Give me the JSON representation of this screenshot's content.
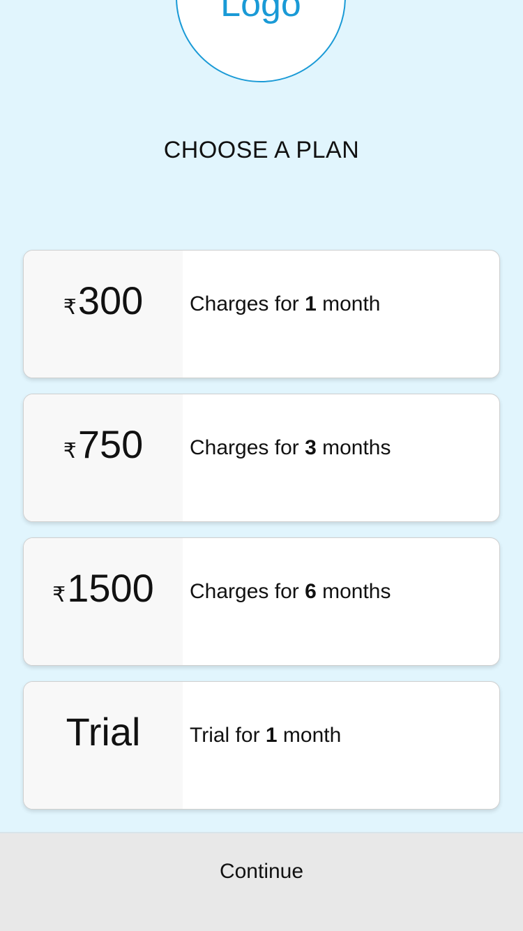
{
  "logo": {
    "text": "Logo"
  },
  "page_title": "CHOOSE A PLAN",
  "currency_symbol": "₹",
  "plans": [
    {
      "amount": "300",
      "desc_prefix": "Charges for ",
      "desc_number": "1",
      "desc_suffix": " month",
      "has_currency": true
    },
    {
      "amount": "750",
      "desc_prefix": "Charges for ",
      "desc_number": "3",
      "desc_suffix": " months",
      "has_currency": true
    },
    {
      "amount": "1500",
      "desc_prefix": "Charges for ",
      "desc_number": "6",
      "desc_suffix": " months",
      "has_currency": true
    },
    {
      "amount": "Trial",
      "desc_prefix": "Trial for ",
      "desc_number": "1",
      "desc_suffix": " month",
      "has_currency": false
    }
  ],
  "continue_label": "Continue",
  "colors": {
    "background": "#e1f5fd",
    "accent": "#1a9ad6",
    "card": "#ffffff",
    "price_panel": "#f8f8f8",
    "footer": "#e8e8e8"
  }
}
